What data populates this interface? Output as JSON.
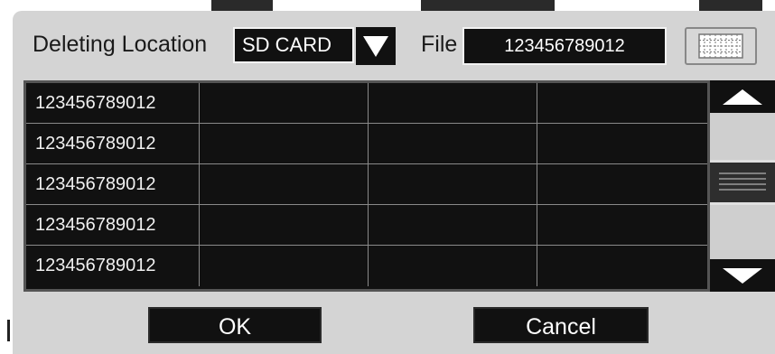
{
  "dialog": {
    "location_label": "Deleting Location",
    "location_value": "SD CARD",
    "file_label": "File",
    "file_value": "123456789012"
  },
  "file_list": {
    "rows": [
      {
        "name": "123456789012",
        "c2": "",
        "c3": "",
        "c4": ""
      },
      {
        "name": "123456789012",
        "c2": "",
        "c3": "",
        "c4": ""
      },
      {
        "name": "123456789012",
        "c2": "",
        "c3": "",
        "c4": ""
      },
      {
        "name": "123456789012",
        "c2": "",
        "c3": "",
        "c4": ""
      },
      {
        "name": "123456789012",
        "c2": "",
        "c3": "",
        "c4": ""
      }
    ]
  },
  "buttons": {
    "ok_label": "OK",
    "cancel_label": "Cancel"
  },
  "icons": {
    "dropdown": "triangle-down-icon",
    "keyboard": "keyboard-icon",
    "scroll_up": "triangle-up-icon",
    "scroll_down": "triangle-down-icon",
    "scroll_thumb": "grip-lines-icon"
  },
  "colors": {
    "panel": "#d4d4d4",
    "field_bg": "#111111",
    "text_light": "#ffffff",
    "text_dark": "#1a1a1a"
  }
}
